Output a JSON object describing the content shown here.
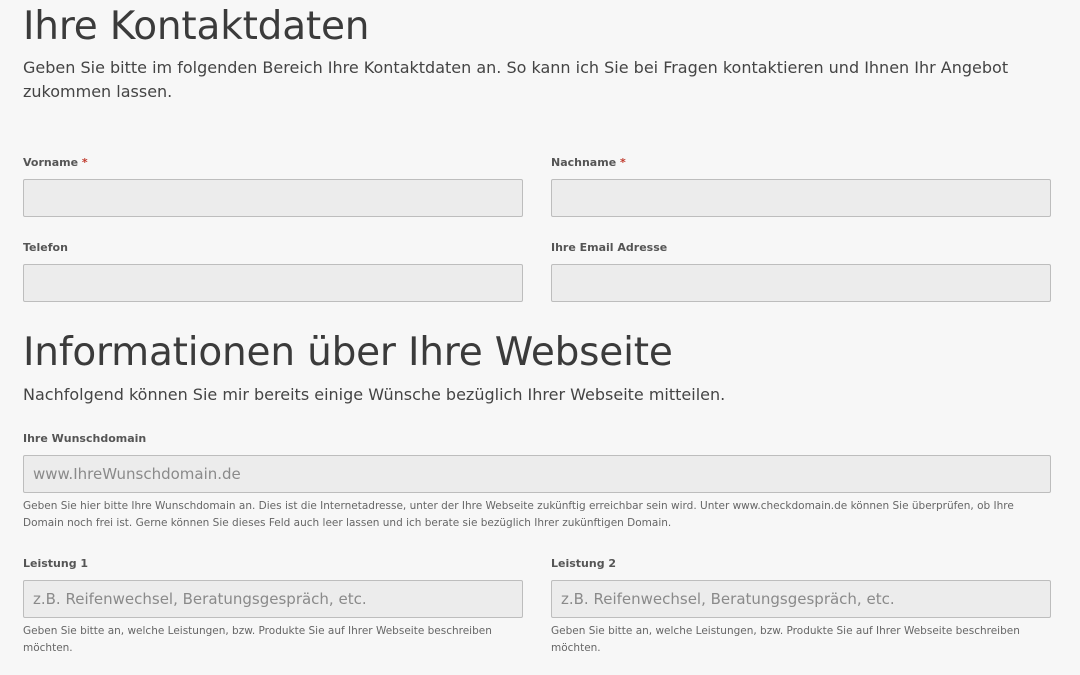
{
  "contact_section": {
    "title": "Ihre Kontaktdaten",
    "intro": "Geben Sie bitte im folgenden Bereich Ihre Kontaktdaten an. So kann ich Sie bei Fragen kontaktieren und Ihnen Ihr Angebot zukommen lassen.",
    "required_marker": "*",
    "fields": {
      "vorname": {
        "label": "Vorname",
        "value": "",
        "required": true
      },
      "nachname": {
        "label": "Nachname",
        "value": "",
        "required": true
      },
      "telefon": {
        "label": "Telefon",
        "value": ""
      },
      "email": {
        "label": "Ihre Email Adresse",
        "value": ""
      }
    }
  },
  "website_section": {
    "title": "Informationen über Ihre Webseite",
    "intro": "Nachfolgend können Sie mir bereits einige Wünsche bezüglich Ihrer Webseite mitteilen.",
    "fields": {
      "wunschdomain": {
        "label": "Ihre Wunschdomain",
        "placeholder": "www.IhreWunschdomain.de",
        "value": "",
        "help": "Geben Sie hier bitte Ihre Wunschdomain an. Dies ist die Internetadresse, unter der Ihre Webseite zukünftig erreichbar sein wird. Unter www.checkdomain.de können Sie überprüfen, ob Ihre Domain noch frei ist. Gerne können Sie dieses Feld auch leer lassen und ich berate sie bezüglich Ihrer zukünftigen Domain."
      },
      "leistung1": {
        "label": "Leistung 1",
        "placeholder": "z.B. Reifenwechsel, Beratungsgespräch, etc.",
        "value": "",
        "help": "Geben Sie bitte an, welche Leistungen, bzw. Produkte Sie auf Ihrer Webseite beschreiben möchten."
      },
      "leistung2": {
        "label": "Leistung 2",
        "placeholder": "z.B. Reifenwechsel, Beratungsgespräch, etc.",
        "value": "",
        "help": "Geben Sie bitte an, welche Leistungen, bzw. Produkte Sie auf Ihrer Webseite beschreiben möchten."
      }
    }
  }
}
